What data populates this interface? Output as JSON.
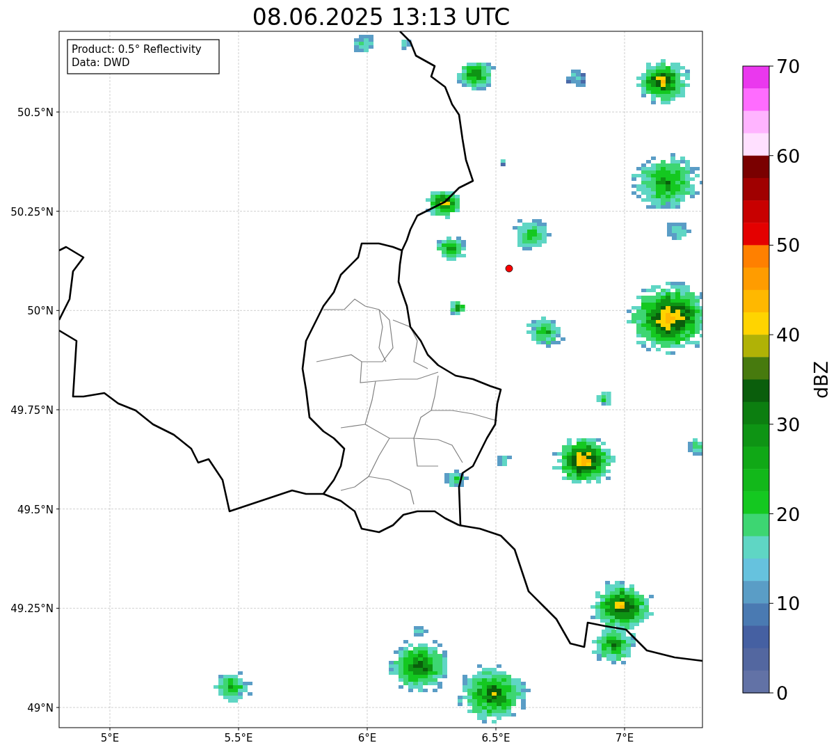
{
  "title": "08.06.2025 13:13 UTC",
  "info_box": [
    "Product: 0.5° Reflectivity",
    "Data: DWD"
  ],
  "lat_labels": [
    "50.5°N",
    "50.25°N",
    "50°N",
    "49.75°N",
    "49.5°N",
    "49.25°N",
    "49°N"
  ],
  "lon_labels": [
    "5°E",
    "5.5°E",
    "6°E",
    "6.5°E",
    "7°E"
  ],
  "colorbar": {
    "label": "dBZ",
    "ticks": [
      "70",
      "60",
      "50",
      "40",
      "30",
      "20",
      "10",
      "0"
    ],
    "segments": [
      {
        "color": "#ea38ee"
      },
      {
        "color": "#ff6cff"
      },
      {
        "color": "#ffb4ff"
      },
      {
        "color": "#ffe0ff"
      },
      {
        "color": "#7a0000"
      },
      {
        "color": "#a00000"
      },
      {
        "color": "#c80000"
      },
      {
        "color": "#e40000"
      },
      {
        "color": "#ff8000"
      },
      {
        "color": "#ff9c00"
      },
      {
        "color": "#ffb800"
      },
      {
        "color": "#ffd400"
      },
      {
        "color": "#b0b206"
      },
      {
        "color": "#477a0e"
      },
      {
        "color": "#0a5e0c"
      },
      {
        "color": "#0c7e10"
      },
      {
        "color": "#0e9414"
      },
      {
        "color": "#10a816"
      },
      {
        "color": "#12b81a"
      },
      {
        "color": "#14c820"
      },
      {
        "color": "#3dd672"
      },
      {
        "color": "#5fd6c4"
      },
      {
        "color": "#66c2de"
      },
      {
        "color": "#5a9dc6"
      },
      {
        "color": "#4a7ab2"
      },
      {
        "color": "#4560a2"
      },
      {
        "color": "#5367a0"
      },
      {
        "color": "#6272a6"
      }
    ]
  }
}
